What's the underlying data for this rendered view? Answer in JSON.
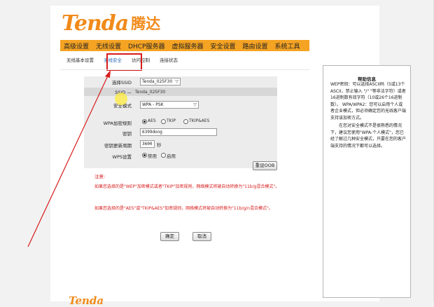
{
  "brand": {
    "name_en": "Tenda",
    "name_cn": "腾达",
    "color": "#f18a1a"
  },
  "nav": [
    "高级设置",
    "无线设置",
    "DHCP服务器",
    "虚拟服务器",
    "安全设置",
    "路由设置",
    "系统工具"
  ],
  "subnav": {
    "items": [
      "无线基本设置",
      "无线安全",
      "访问控制",
      "连接状态"
    ],
    "active_index": 1
  },
  "form": {
    "select_ssid_label": "选择SSID",
    "select_ssid_value": "Tenda_025F30",
    "ssid_label": "SSID —",
    "ssid_value": "Tenda_025F30",
    "security_mode_label": "安全模式",
    "security_mode_value": "WPA - PSK",
    "wpa_algo_label": "WPA加密规则",
    "wpa_algo_options": [
      "AES",
      "TKIP",
      "TKIP&AES"
    ],
    "wpa_algo_selected": 0,
    "password_label": "密钥",
    "password_value": "6399dong",
    "renew_label": "密钥更新周期",
    "renew_value": "3600",
    "renew_unit": "秒",
    "wps_label": "WPS设置",
    "wps_options": [
      "禁用",
      "启用"
    ],
    "wps_selected": 0,
    "reset_oob_label": "重设OOB"
  },
  "notes": {
    "title": "注意:",
    "line1": "如果您选择的是\"WEP\"加密模式或者\"TKIP\"加密规则，网络模式将被自动转换为\"11b/g混合模式\"。",
    "line2": "如果您选择的是\"AES\"或\"TKIP&AES\"加密规则，网络模式将被自动转换为\"11b/g/n混合模式\"。"
  },
  "buttons": {
    "ok": "确定",
    "cancel": "取消"
  },
  "help": {
    "title": "帮助信息",
    "p1": "WEP密钥：可以选择ASCII码（5或13个ASCII，禁止输入 \"/\" \"等非法字符）或者16进制数有效字符（10或26个16进制数）。 WPA/WPA2：您可以启用个人或者企业模式，但必须确定您的无线客户端支持该加密方式。",
    "p2": "在您对安全模式不是很熟悉的情况下，建议您使用\"WPA-个人模式\"，您已经了解过几种安全模式，只要在您的客户端支持的情况下都可以选择。"
  },
  "footer": {
    "brand": "Tenda"
  }
}
